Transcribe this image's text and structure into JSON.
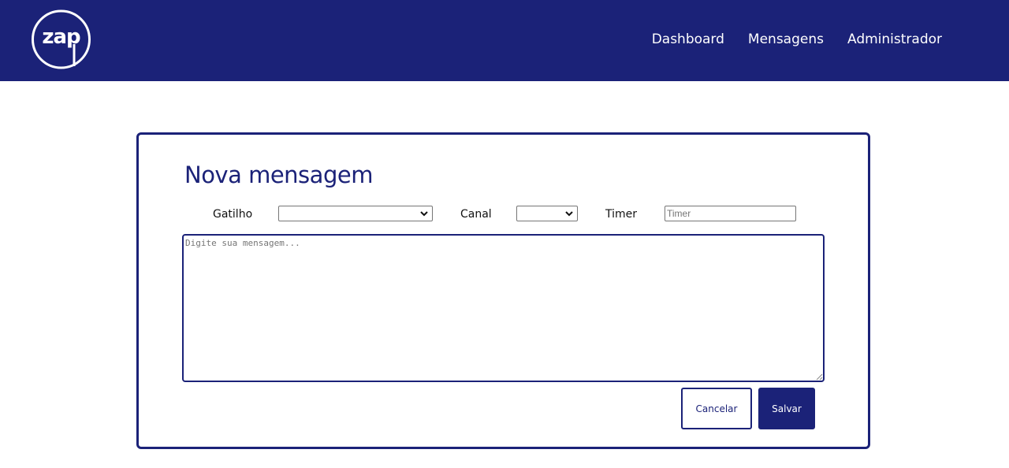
{
  "header": {
    "logo_text": "zap",
    "nav": [
      {
        "label": "Dashboard"
      },
      {
        "label": "Mensagens"
      },
      {
        "label": "Administrador"
      }
    ]
  },
  "form": {
    "title": "Nova mensagem",
    "gatilho": {
      "label": "Gatilho",
      "value": ""
    },
    "canal": {
      "label": "Canal",
      "value": ""
    },
    "timer": {
      "label": "Timer",
      "placeholder": "Timer",
      "value": ""
    },
    "message": {
      "placeholder": "Digite sua mensagem...",
      "value": ""
    },
    "cancel_label": "Cancelar",
    "save_label": "Salvar"
  },
  "colors": {
    "brand": "#1b2278",
    "background": "#ffffff"
  },
  "icons": {
    "logo": "zap-logo-icon",
    "dropdown": "chevron-down-icon",
    "resize": "resize-grip-icon"
  }
}
